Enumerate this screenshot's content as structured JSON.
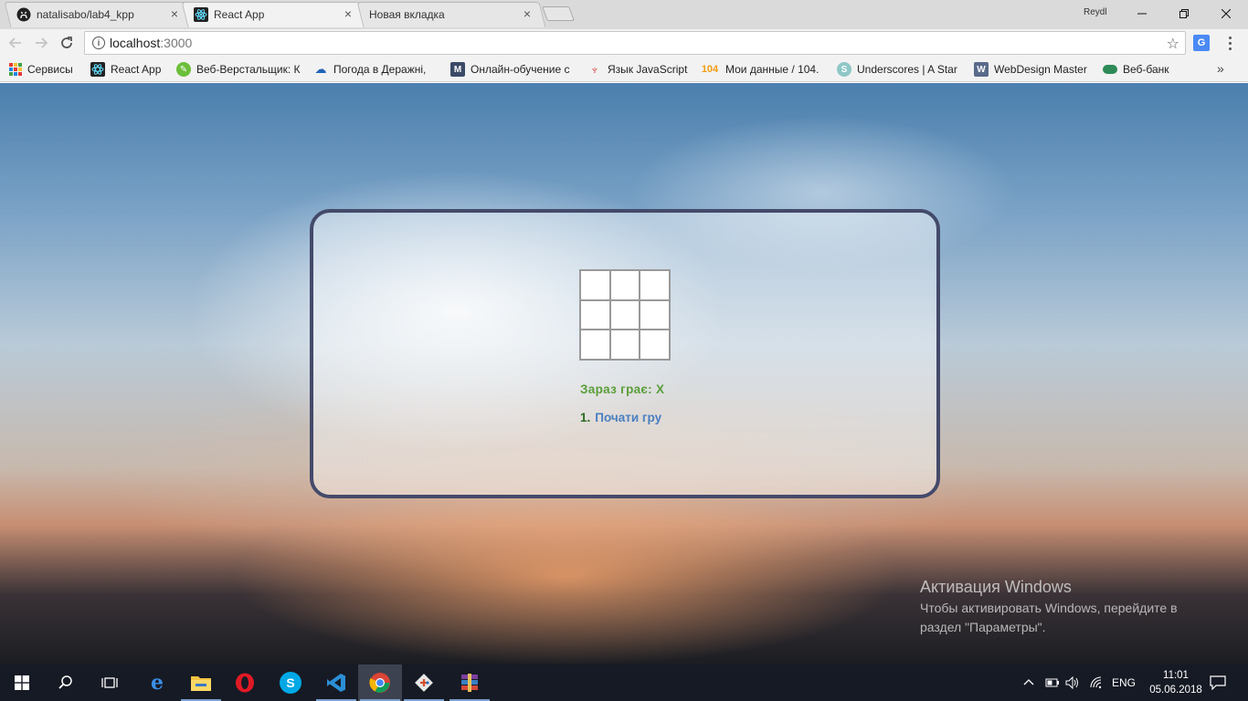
{
  "browser": {
    "tabs": [
      {
        "title": "natalisabo/lab4_kpp",
        "icon": "github-icon",
        "active": false
      },
      {
        "title": "React App",
        "icon": "react-icon",
        "active": true
      },
      {
        "title": "Новая вкладка",
        "icon": "",
        "active": false
      }
    ],
    "profile_name": "Reydl",
    "address": {
      "host": "localhost",
      "port": ":3000"
    },
    "bookmarks": [
      {
        "label": "Сервисы",
        "icon": "apps-icon"
      },
      {
        "label": "React App",
        "icon": "react-icon"
      },
      {
        "label": "Веб-Верстальщик: К",
        "icon": "leaf-icon"
      },
      {
        "label": "Погода в Деражні, ",
        "icon": "weather-icon"
      },
      {
        "label": "Онлайн-обучение с",
        "icon": "m-icon"
      },
      {
        "label": "Язык JavaScript",
        "icon": "tower-icon"
      },
      {
        "label": "Мои данные / 104.",
        "icon": "104-icon"
      },
      {
        "label": "Underscores | A Star",
        "icon": "s-icon"
      },
      {
        "label": "WebDesign Master",
        "icon": "w-icon"
      },
      {
        "label": "Веб-банк",
        "icon": "bank-icon"
      }
    ],
    "icon_glyphs": {
      "104": "104",
      "m": "M",
      "s": "S",
      "w": "W",
      "info": "i",
      "translate": "G"
    }
  },
  "game": {
    "board": [
      "",
      "",
      "",
      "",
      "",
      "",
      "",
      "",
      ""
    ],
    "status": "Зараз грає: X",
    "moves": [
      {
        "number": "1.",
        "label": "Почати гру"
      }
    ]
  },
  "windows_activation": {
    "title": "Активация Windows",
    "text": "Чтобы активировать Windows, перейдите в раздел \"Параметры\"."
  },
  "taskbar": {
    "apps": [
      "start-icon",
      "search-icon",
      "task-view-icon",
      "edge-icon",
      "file-explorer-icon",
      "opera-icon",
      "skype-icon",
      "vscode-icon",
      "chrome-icon",
      "git-icon",
      "winrar-icon"
    ],
    "language": "ENG",
    "time": "11:01",
    "date": "05.06.2018"
  },
  "colors": {
    "panel_border": "#444a6a",
    "status_text": "#5a9e3a",
    "move_link": "#4a7fc0",
    "move_number": "#2a6b22"
  }
}
